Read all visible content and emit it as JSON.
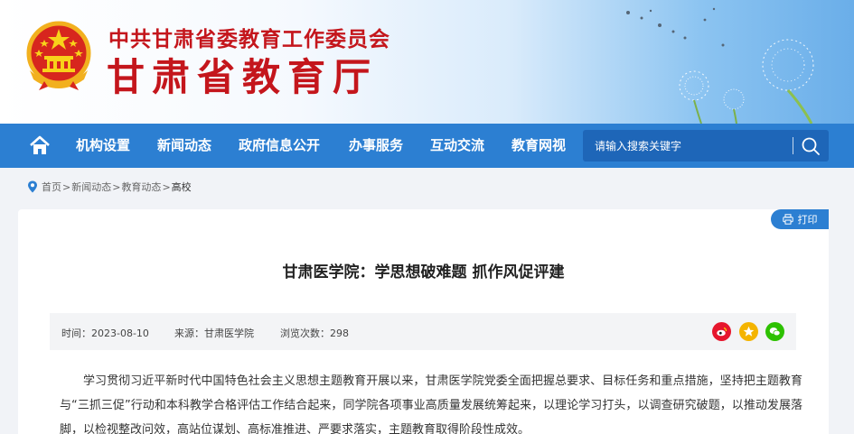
{
  "header": {
    "org_top": "中共甘肃省委教育工作委员会",
    "org_main": "甘肃省教育厅"
  },
  "nav": {
    "items": [
      {
        "label": "机构设置"
      },
      {
        "label": "新闻动态"
      },
      {
        "label": "政府信息公开"
      },
      {
        "label": "办事服务"
      },
      {
        "label": "互动交流"
      },
      {
        "label": "教育网视"
      }
    ],
    "search_placeholder": "请输入搜索关键字"
  },
  "breadcrumb": {
    "items": [
      "首页",
      "新闻动态",
      "教育动态"
    ],
    "separator": ">",
    "current": "高校"
  },
  "toolbar": {
    "print_label": "打印"
  },
  "article": {
    "title": "甘肃医学院：学思想破难题 抓作风促评建",
    "date": "时间：2023-08-10",
    "source": "来源：甘肃医学院",
    "views": "浏览次数：298",
    "body": "学习贯彻习近平新时代中国特色社会主义思想主题教育开展以来，甘肃医学院党委全面把握总要求、目标任务和重点措施，坚持把主题教育与“三抓三促”行动和本科教学合格评估工作结合起来，同学院各项事业高质量发展统筹起来，以理论学习打头，以调查研究破题，以推动发展落脚，以检视整改问效，高站位谋划、高标准推进、严要求落实，主题教育取得阶段性成效。"
  },
  "share": [
    {
      "icon": "weibo-icon",
      "color": "#e6162d"
    },
    {
      "icon": "qzone-icon",
      "color": "#f4b400"
    },
    {
      "icon": "wechat-icon",
      "color": "#2dc100"
    }
  ],
  "colors": {
    "brand_red": "#c4161c",
    "nav_blue": "#2c7fd2",
    "search_blue": "#1e66b8"
  }
}
